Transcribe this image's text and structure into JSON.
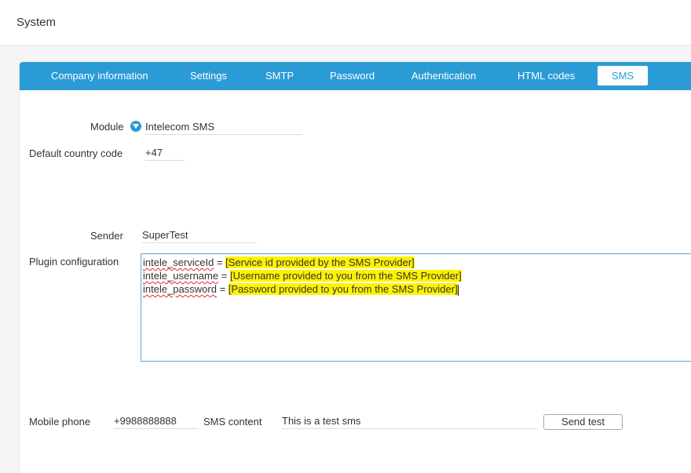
{
  "header": {
    "title": "System"
  },
  "tabs": [
    {
      "label": "Company information",
      "active": false
    },
    {
      "label": "Settings",
      "active": false
    },
    {
      "label": "SMTP",
      "active": false
    },
    {
      "label": "Password",
      "active": false
    },
    {
      "label": "Authentication",
      "active": false
    },
    {
      "label": "HTML codes",
      "active": false
    },
    {
      "label": "SMS",
      "active": true
    }
  ],
  "form": {
    "module_label": "Module",
    "module_value": "Intelecom SMS",
    "country_label": "Default country code",
    "country_value": "+47",
    "sender_label": "Sender",
    "sender_value": "SuperTest",
    "plugin_label": "Plugin configuration",
    "config_lines": [
      {
        "key": "intele_serviceId",
        "sep": " = ",
        "value": "[Service id provided by the SMS Provider]"
      },
      {
        "key": "intele_username",
        "sep": " = ",
        "value": "[Username provided to you from the SMS Provider]"
      },
      {
        "key": "intele_password",
        "sep": " = ",
        "value": "[Password provided to you from the SMS Provider]"
      }
    ],
    "mobile_label": "Mobile phone",
    "mobile_value": "+9988888888",
    "content_label": "SMS content",
    "content_value": "This is a test sms",
    "send_label": "Send test"
  },
  "colors": {
    "accent": "#2b9bd6",
    "highlight": "#fff200"
  }
}
